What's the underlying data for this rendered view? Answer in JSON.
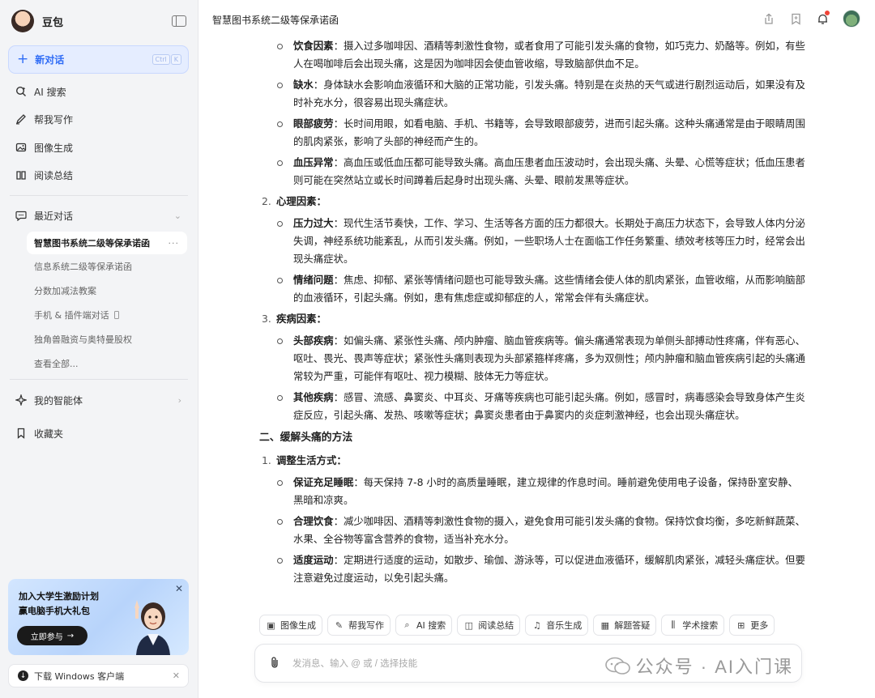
{
  "sidebar": {
    "app_name": "豆包",
    "new_chat": {
      "label": "新对话",
      "shortcut": [
        "Ctrl",
        "K"
      ]
    },
    "nav": [
      {
        "label": "AI 搜索",
        "icon": "ai-search-icon"
      },
      {
        "label": "帮我写作",
        "icon": "pen-icon"
      },
      {
        "label": "图像生成",
        "icon": "image-icon"
      },
      {
        "label": "阅读总结",
        "icon": "book-icon"
      }
    ],
    "recent": {
      "label": "最近对话",
      "items": [
        {
          "label": "智慧图书系统二级等保承诺函",
          "active": true
        },
        {
          "label": "信息系统二级等保承诺函"
        },
        {
          "label": "分数加减法教案"
        },
        {
          "label": "手机 & 插件端对话"
        },
        {
          "label": "独角兽融资与奥特曼股权"
        }
      ],
      "view_all": "查看全部..."
    },
    "agents_label": "我的智能体",
    "favorites_label": "收藏夹",
    "promo": {
      "line1": "加入大学生激励计划",
      "line2": "赢电脑手机大礼包",
      "button": "立即参与"
    },
    "download_label": "下载 Windows 客户端"
  },
  "header": {
    "title": "智慧图书系统二级等保承诺函"
  },
  "content": {
    "bullets_a": [
      {
        "term": "饮食因素",
        "text": "：摄入过多咖啡因、酒精等刺激性食物，或者食用了可能引发头痛的食物，如巧克力、奶酪等。例如，有些人在喝咖啡后会出现头痛，这是因为咖啡因会使血管收缩，导致脑部供血不足。"
      },
      {
        "term": "缺水",
        "text": "：身体缺水会影响血液循环和大脑的正常功能，引发头痛。特别是在炎热的天气或进行剧烈运动后，如果没有及时补充水分，很容易出现头痛症状。"
      },
      {
        "term": "眼部疲劳",
        "text": "：长时间用眼，如看电脑、手机、书籍等，会导致眼部疲劳，进而引起头痛。这种头痛通常是由于眼睛周围的肌肉紧张，影响了头部的神经而产生的。"
      },
      {
        "term": "血压异常",
        "text": "：高血压或低血压都可能导致头痛。高血压患者血压波动时，会出现头痛、头晕、心慌等症状；低血压患者则可能在突然站立或长时间蹲着后起身时出现头痛、头晕、眼前发黑等症状。"
      }
    ],
    "h2": {
      "num": "2.",
      "label": "心理因素："
    },
    "bullets_b": [
      {
        "term": "压力过大",
        "text": "：现代生活节奏快，工作、学习、生活等各方面的压力都很大。长期处于高压力状态下，会导致人体内分泌失调，神经系统功能紊乱，从而引发头痛。例如，一些职场人士在面临工作任务繁重、绩效考核等压力时，经常会出现头痛症状。"
      },
      {
        "term": "情绪问题",
        "text": "：焦虑、抑郁、紧张等情绪问题也可能导致头痛。这些情绪会使人体的肌肉紧张，血管收缩，从而影响脑部的血液循环，引起头痛。例如，患有焦虑症或抑郁症的人，常常会伴有头痛症状。"
      }
    ],
    "h3": {
      "num": "3.",
      "label": "疾病因素："
    },
    "bullets_c": [
      {
        "term": "头部疾病",
        "text": "：如偏头痛、紧张性头痛、颅内肿瘤、脑血管疾病等。偏头痛通常表现为单侧头部搏动性疼痛，伴有恶心、呕吐、畏光、畏声等症状；紧张性头痛则表现为头部紧箍样疼痛，多为双侧性；颅内肿瘤和脑血管疾病引起的头痛通常较为严重，可能伴有呕吐、视力模糊、肢体无力等症状。"
      },
      {
        "term": "其他疾病",
        "text": "：感冒、流感、鼻窦炎、中耳炎、牙痛等疾病也可能引起头痛。例如，感冒时，病毒感染会导致身体产生炎症反应，引起头痛、发热、咳嗽等症状；鼻窦炎患者由于鼻窦内的炎症刺激神经，也会出现头痛症状。"
      }
    ],
    "section2": "二、缓解头痛的方法",
    "h4": {
      "num": "1.",
      "label": "调整生活方式："
    },
    "bullets_d": [
      {
        "term": "保证充足睡眠",
        "text": "：每天保持 7-8 小时的高质量睡眠，建立规律的作息时间。睡前避免使用电子设备，保持卧室安静、黑暗和凉爽。"
      },
      {
        "term": "合理饮食",
        "text": "：减少咖啡因、酒精等刺激性食物的摄入，避免食用可能引发头痛的食物。保持饮食均衡，多吃新鲜蔬菜、水果、全谷物等富含营养的食物，适当补充水分。"
      },
      {
        "term": "适度运动",
        "text": "：定期进行适度的运动，如散步、瑜伽、游泳等，可以促进血液循环，缓解肌肉紧张，减轻头痛症状。但要注意避免过度运动，以免引起头痛。"
      }
    ]
  },
  "tools": [
    {
      "label": "图像生成",
      "icon": "image-icon"
    },
    {
      "label": "帮我写作",
      "icon": "pen-icon"
    },
    {
      "label": "AI 搜索",
      "icon": "ai-search-icon"
    },
    {
      "label": "阅读总结",
      "icon": "book-icon"
    },
    {
      "label": "音乐生成",
      "icon": "music-icon"
    },
    {
      "label": "解题答疑",
      "icon": "calculator-icon"
    },
    {
      "label": "学术搜索",
      "icon": "library-icon"
    },
    {
      "label": "更多",
      "icon": "grid-icon"
    }
  ],
  "input": {
    "placeholder": "发消息、输入 @ 或 / 选择技能"
  },
  "watermark": {
    "text": "公众号 · AI入门课"
  },
  "colors": {
    "accent": "#2f6cf6",
    "sidebar_bg": "#f3f4f6",
    "notification": "#f04438"
  }
}
